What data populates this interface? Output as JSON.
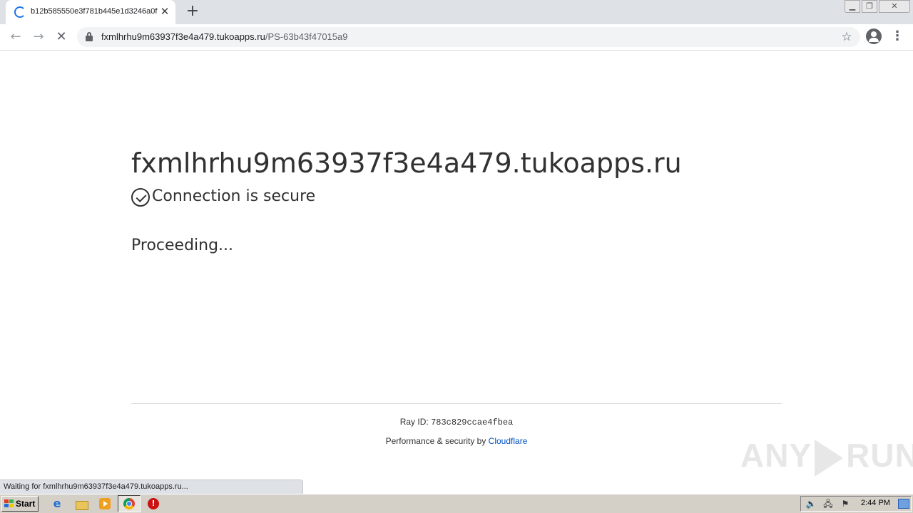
{
  "browser": {
    "tab": {
      "title": "b12b585550e3f781b445e1d3246a0f",
      "close_glyph": "✕"
    },
    "new_tab_glyph": "+",
    "window_controls": {
      "minimize": "▁",
      "maximize": "❐",
      "close": "✕"
    },
    "toolbar": {
      "back_glyph": "←",
      "forward_glyph": "→",
      "stop_glyph": "✕",
      "url_host": "fxmlhrhu9m63937f3e4a479.tukoapps.ru",
      "url_path": "/PS-63b43f47015a9",
      "star_glyph": "☆",
      "menu_glyph": "⋮"
    },
    "status_text": "Waiting for fxmlhrhu9m63937f3e4a479.tukoapps.ru..."
  },
  "page": {
    "host": "fxmlhrhu9m63937f3e4a479.tukoapps.ru",
    "secure_text": "Connection is secure",
    "proceeding_text": "Proceeding...",
    "ray_label": "Ray ID: ",
    "ray_id": "783c829ccae4fbea",
    "perf_label": "Performance & security by ",
    "perf_link": "Cloudflare"
  },
  "watermark": {
    "left": "ANY",
    "right": "RUN"
  },
  "taskbar": {
    "start_label": "Start",
    "ie_glyph": "e",
    "clock": "2:44 PM",
    "tray_glyphs": {
      "volume": "🔈",
      "network": "🖧",
      "flag": "⚑"
    }
  },
  "colors": {
    "accent": "#1a73e8",
    "link": "#0051c3",
    "text": "#313131"
  }
}
